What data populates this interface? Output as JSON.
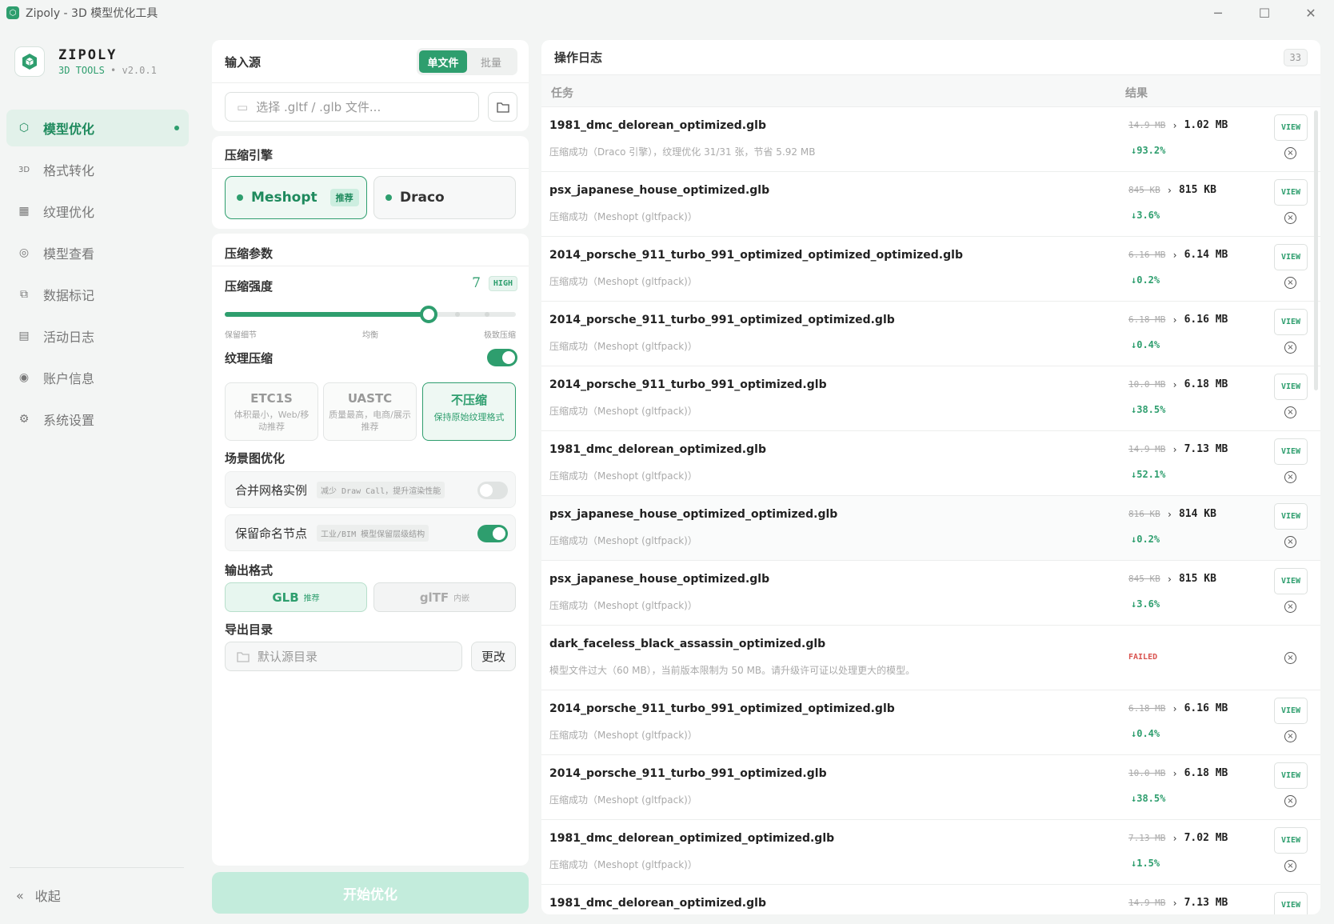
{
  "window": {
    "title": "Zipoly - 3D 模型优化工具"
  },
  "brand": {
    "name": "ZIPOLY",
    "sub": "3D TOOLS",
    "version": "• v2.0.1"
  },
  "nav": [
    {
      "label": "模型优化",
      "icon": "cube-icon",
      "active": true
    },
    {
      "label": "格式转化",
      "icon": "3d-text-icon"
    },
    {
      "label": "纹理优化",
      "icon": "checker-icon"
    },
    {
      "label": "模型查看",
      "icon": "scan-icon"
    },
    {
      "label": "数据标记",
      "icon": "copy-icon"
    },
    {
      "label": "活动日志",
      "icon": "calendar-icon"
    },
    {
      "label": "账户信息",
      "icon": "user-icon"
    },
    {
      "label": "系统设置",
      "icon": "gear-icon"
    }
  ],
  "collapse_label": "收起",
  "input": {
    "title": "输入源",
    "mode_single": "单文件",
    "mode_batch": "批量",
    "placeholder": "选择 .gltf / .glb 文件..."
  },
  "engine": {
    "title": "压缩引擎",
    "meshopt": "Meshopt",
    "meshopt_tag": "推荐",
    "draco": "Draco"
  },
  "params": {
    "title": "压缩参数",
    "strength_label": "压缩强度",
    "strength_value": "7",
    "strength_level": "HIGH",
    "strength_fraction": 0.7,
    "mark_low": "保留细节",
    "mark_mid": "均衡",
    "mark_high": "极致压缩",
    "texture_label": "纹理压缩",
    "texture_on": true,
    "tex_options": [
      {
        "name": "ETC1S",
        "desc": "体积最小，Web/移动推荐"
      },
      {
        "name": "UASTC",
        "desc": "质量最高，电商/展示推荐"
      },
      {
        "name": "不压缩",
        "desc": "保持原始纹理格式",
        "selected": true
      }
    ],
    "scene_label": "场景图优化",
    "merge_label": "合并网格实例",
    "merge_hint": "减少 Draw Call，提升渲染性能",
    "merge_on": false,
    "keep_label": "保留命名节点",
    "keep_hint": "工业/BIM 模型保留层级结构",
    "keep_on": true,
    "format_label": "输出格式",
    "glb": "GLB",
    "glb_tag": "推荐",
    "gltf": "glTF",
    "gltf_tag": "内嵌",
    "dir_label": "导出目录",
    "dir_placeholder": "默认源目录",
    "change_btn": "更改"
  },
  "start_btn": "开始优化",
  "log": {
    "title": "操作日志",
    "count": "33",
    "col_task": "任务",
    "col_result": "结果",
    "view_label": "VIEW",
    "rows": [
      {
        "name": "1981_dmc_delorean_optimized.glb",
        "desc": "压缩成功（Draco 引擎），纹理优化 31/31 张，节省 5.92 MB",
        "old": "14.9 MB",
        "new": "1.02 MB",
        "pct": "↓93.2%"
      },
      {
        "name": "psx_japanese_house_optimized.glb",
        "desc": "压缩成功（Meshopt (gltfpack)）",
        "old": "845 KB",
        "new": "815 KB",
        "pct": "↓3.6%"
      },
      {
        "name": "2014_porsche_911_turbo_991_optimized_optimized_optimized.glb",
        "desc": "压缩成功（Meshopt (gltfpack)）",
        "old": "6.16 MB",
        "new": "6.14 MB",
        "pct": "↓0.2%"
      },
      {
        "name": "2014_porsche_911_turbo_991_optimized_optimized.glb",
        "desc": "压缩成功（Meshopt (gltfpack)）",
        "old": "6.18 MB",
        "new": "6.16 MB",
        "pct": "↓0.4%"
      },
      {
        "name": "2014_porsche_911_turbo_991_optimized.glb",
        "desc": "压缩成功（Meshopt (gltfpack)）",
        "old": "10.0 MB",
        "new": "6.18 MB",
        "pct": "↓38.5%"
      },
      {
        "name": "1981_dmc_delorean_optimized.glb",
        "desc": "压缩成功（Meshopt (gltfpack)）",
        "old": "14.9 MB",
        "new": "7.13 MB",
        "pct": "↓52.1%"
      },
      {
        "name": "psx_japanese_house_optimized_optimized.glb",
        "desc": "压缩成功（Meshopt (gltfpack)）",
        "old": "816 KB",
        "new": "814 KB",
        "pct": "↓0.2%",
        "alt": true
      },
      {
        "name": "psx_japanese_house_optimized.glb",
        "desc": "压缩成功（Meshopt (gltfpack)）",
        "old": "845 KB",
        "new": "815 KB",
        "pct": "↓3.6%"
      },
      {
        "name": "dark_faceless_black_assassin_optimized.glb",
        "desc": "模型文件过大（60 MB），当前版本限制为 50 MB。请升级许可证以处理更大的模型。",
        "failed": "FAILED"
      },
      {
        "name": "2014_porsche_911_turbo_991_optimized_optimized.glb",
        "desc": "压缩成功（Meshopt (gltfpack)）",
        "old": "6.18 MB",
        "new": "6.16 MB",
        "pct": "↓0.4%"
      },
      {
        "name": "2014_porsche_911_turbo_991_optimized.glb",
        "desc": "压缩成功（Meshopt (gltfpack)）",
        "old": "10.0 MB",
        "new": "6.18 MB",
        "pct": "↓38.5%"
      },
      {
        "name": "1981_dmc_delorean_optimized_optimized.glb",
        "desc": "压缩成功（Meshopt (gltfpack)）",
        "old": "7.13 MB",
        "new": "7.02 MB",
        "pct": "↓1.5%"
      },
      {
        "name": "1981_dmc_delorean_optimized.glb",
        "desc": "",
        "old": "14.9 MB",
        "new": "7.13 MB",
        "pct": ""
      }
    ]
  },
  "colors": {
    "accent": "#2e9e6e",
    "accent_light": "#e2f1ea",
    "fail": "#d9534f"
  }
}
